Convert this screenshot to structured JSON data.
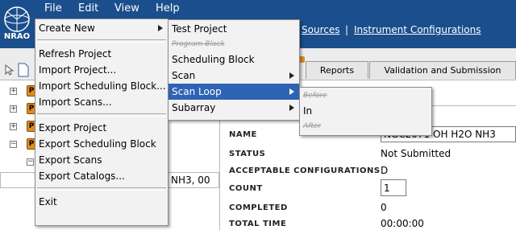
{
  "menubar": {
    "logo_text": "NRAO",
    "file": "File",
    "edit": "Edit",
    "view": "View",
    "help": "Help"
  },
  "navlinks": {
    "sources": "Sources",
    "separator": "|",
    "instrument_configurations": "Instrument Configurations"
  },
  "tabs": {
    "reports": "Reports",
    "validation": "Validation and Submission"
  },
  "tree": {
    "node_marker": "P",
    "expanded_item_partial": "NH3, 00"
  },
  "file_menu": {
    "create_new": "Create New",
    "refresh_project": "Refresh Project",
    "import_project": "Import Project...",
    "import_scheduling_block": "Import Scheduling Block...",
    "import_scans": "Import Scans...",
    "export_project": "Export Project",
    "export_scheduling_block": "Export Scheduling Block",
    "export_scans": "Export Scans",
    "export_catalogs": "Export Catalogs...",
    "exit": "Exit"
  },
  "create_new_menu": {
    "test_project": "Test Project",
    "program_block": "Program Block",
    "scheduling_block": "Scheduling Block",
    "scan": "Scan",
    "scan_loop": "Scan Loop",
    "subarray": "Subarray"
  },
  "scan_loop_menu": {
    "before": "Before",
    "in": "In",
    "after": "After"
  },
  "details": {
    "name_label": "NAME",
    "name_value": "NGC2071 OH H2O NH3",
    "status_label": "STATUS",
    "status_value": "Not Submitted",
    "acceptable_label": "ACCEPTABLE CONFIGURATIONS",
    "acceptable_value": "D",
    "count_label": "COUNT",
    "count_value": "1",
    "completed_label": "COMPLETED",
    "completed_value": "0",
    "total_time_label": "TOTAL TIME",
    "total_time_value": "00:00:00"
  },
  "colors": {
    "banner": "#1b4e8c",
    "menu_highlight": "#2f63b3",
    "project_node": "#e08a1e"
  }
}
